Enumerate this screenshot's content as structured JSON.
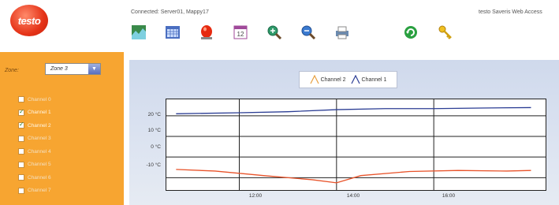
{
  "app": {
    "logo_text": "testo",
    "connection_text": "Connected: Server01, Mappy17",
    "brand_right": "testo Saveris Web Access"
  },
  "toolbar": {
    "icons": [
      "chart-icon",
      "calendar-icon",
      "alarm-icon",
      "date-12-icon",
      "zoom-in-icon",
      "zoom-out-icon",
      "print-icon",
      "refresh-icon",
      "key-icon"
    ]
  },
  "sidebar": {
    "zone_label": "Zone:",
    "zone_value": "Zone 3",
    "channels": [
      {
        "label": "Channel 0",
        "checked": false
      },
      {
        "label": "Channel 1",
        "checked": true
      },
      {
        "label": "Channel 2",
        "checked": true
      },
      {
        "label": "Channel 3",
        "checked": false
      },
      {
        "label": "Channel 4",
        "checked": false
      },
      {
        "label": "Channel 5",
        "checked": false
      },
      {
        "label": "Channel 6",
        "checked": false
      },
      {
        "label": "Channel 7",
        "checked": false
      }
    ]
  },
  "chart_data": {
    "type": "line",
    "legend": [
      "Channel 2",
      "Channel 1"
    ],
    "yticks": [
      "20 °C",
      "10 °C",
      "0 °C",
      "-10 °C"
    ],
    "xticks": [
      "12:00",
      "14:00",
      "16:00"
    ],
    "ylim": [
      -16,
      28
    ],
    "xlim": [
      10.5,
      18.3
    ],
    "grid": true,
    "series": [
      {
        "name": "Channel 1",
        "color": "#2b3d94",
        "x": [
          10.7,
          12.0,
          13.0,
          14.0,
          15.0,
          16.0,
          17.0,
          18.0
        ],
        "y": [
          21,
          21.5,
          22,
          23,
          23.5,
          23.5,
          23.8,
          24
        ]
      },
      {
        "name": "Channel 2",
        "color": "#e8532a",
        "x": [
          10.7,
          11.5,
          12.5,
          13.5,
          14.0,
          14.5,
          15.5,
          16.5,
          17.5,
          18.0
        ],
        "y": [
          -6,
          -6.8,
          -9,
          -11,
          -12.5,
          -9,
          -7,
          -6.5,
          -6.8,
          -6.5
        ]
      }
    ]
  }
}
